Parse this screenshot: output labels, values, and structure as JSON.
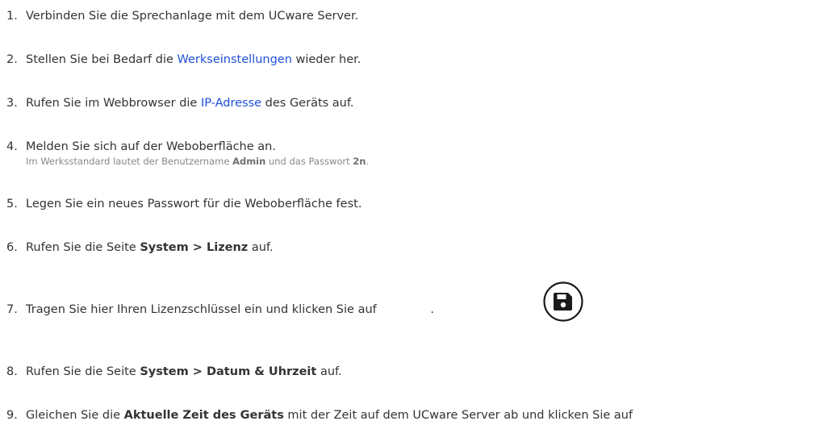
{
  "steps": [
    {
      "number": "1.",
      "text": "Verbinden Sie die Sprechanlage mit dem UCware Server."
    },
    {
      "number": "2.",
      "pre": "Stellen Sie bei Bedarf die ",
      "link": "Werkseinstellungen",
      "post": " wieder her."
    },
    {
      "number": "3.",
      "pre": "Rufen Sie im Webbrowser die ",
      "link": "IP-Adresse",
      "post": " des Geräts auf."
    },
    {
      "number": "4.",
      "text": "Melden Sie sich auf der Weboberfläche an.",
      "note": {
        "pre": "Im Werksstandard lautet der Benutzername ",
        "user": "Admin",
        "mid": " und das Passwort ",
        "password": "2n",
        "post": "."
      }
    },
    {
      "number": "5.",
      "text": "Legen Sie ein neues Passwort für die Weboberfläche fest."
    },
    {
      "number": "6.",
      "pre": "Rufen Sie die Seite ",
      "bold": "System > Lizenz",
      "post": " auf."
    },
    {
      "number": "7.",
      "pre": "Tragen Sie hier Ihren Lizenzschlüssel ein und klicken Sie auf ",
      "post": ".",
      "icon": "save-icon"
    },
    {
      "number": "8.",
      "pre": "Rufen Sie die Seite ",
      "bold": "System > Datum & Uhrzeit",
      "post": " auf."
    },
    {
      "number": "9.",
      "pre": "Gleichen Sie die ",
      "bold": "Aktuelle Zeit des Geräts",
      "post": " mit der Zeit auf dem UCware Server ab und klicken Sie auf"
    }
  ],
  "colors": {
    "text": "#333333",
    "link": "#1e4fd8",
    "note": "#888888"
  }
}
